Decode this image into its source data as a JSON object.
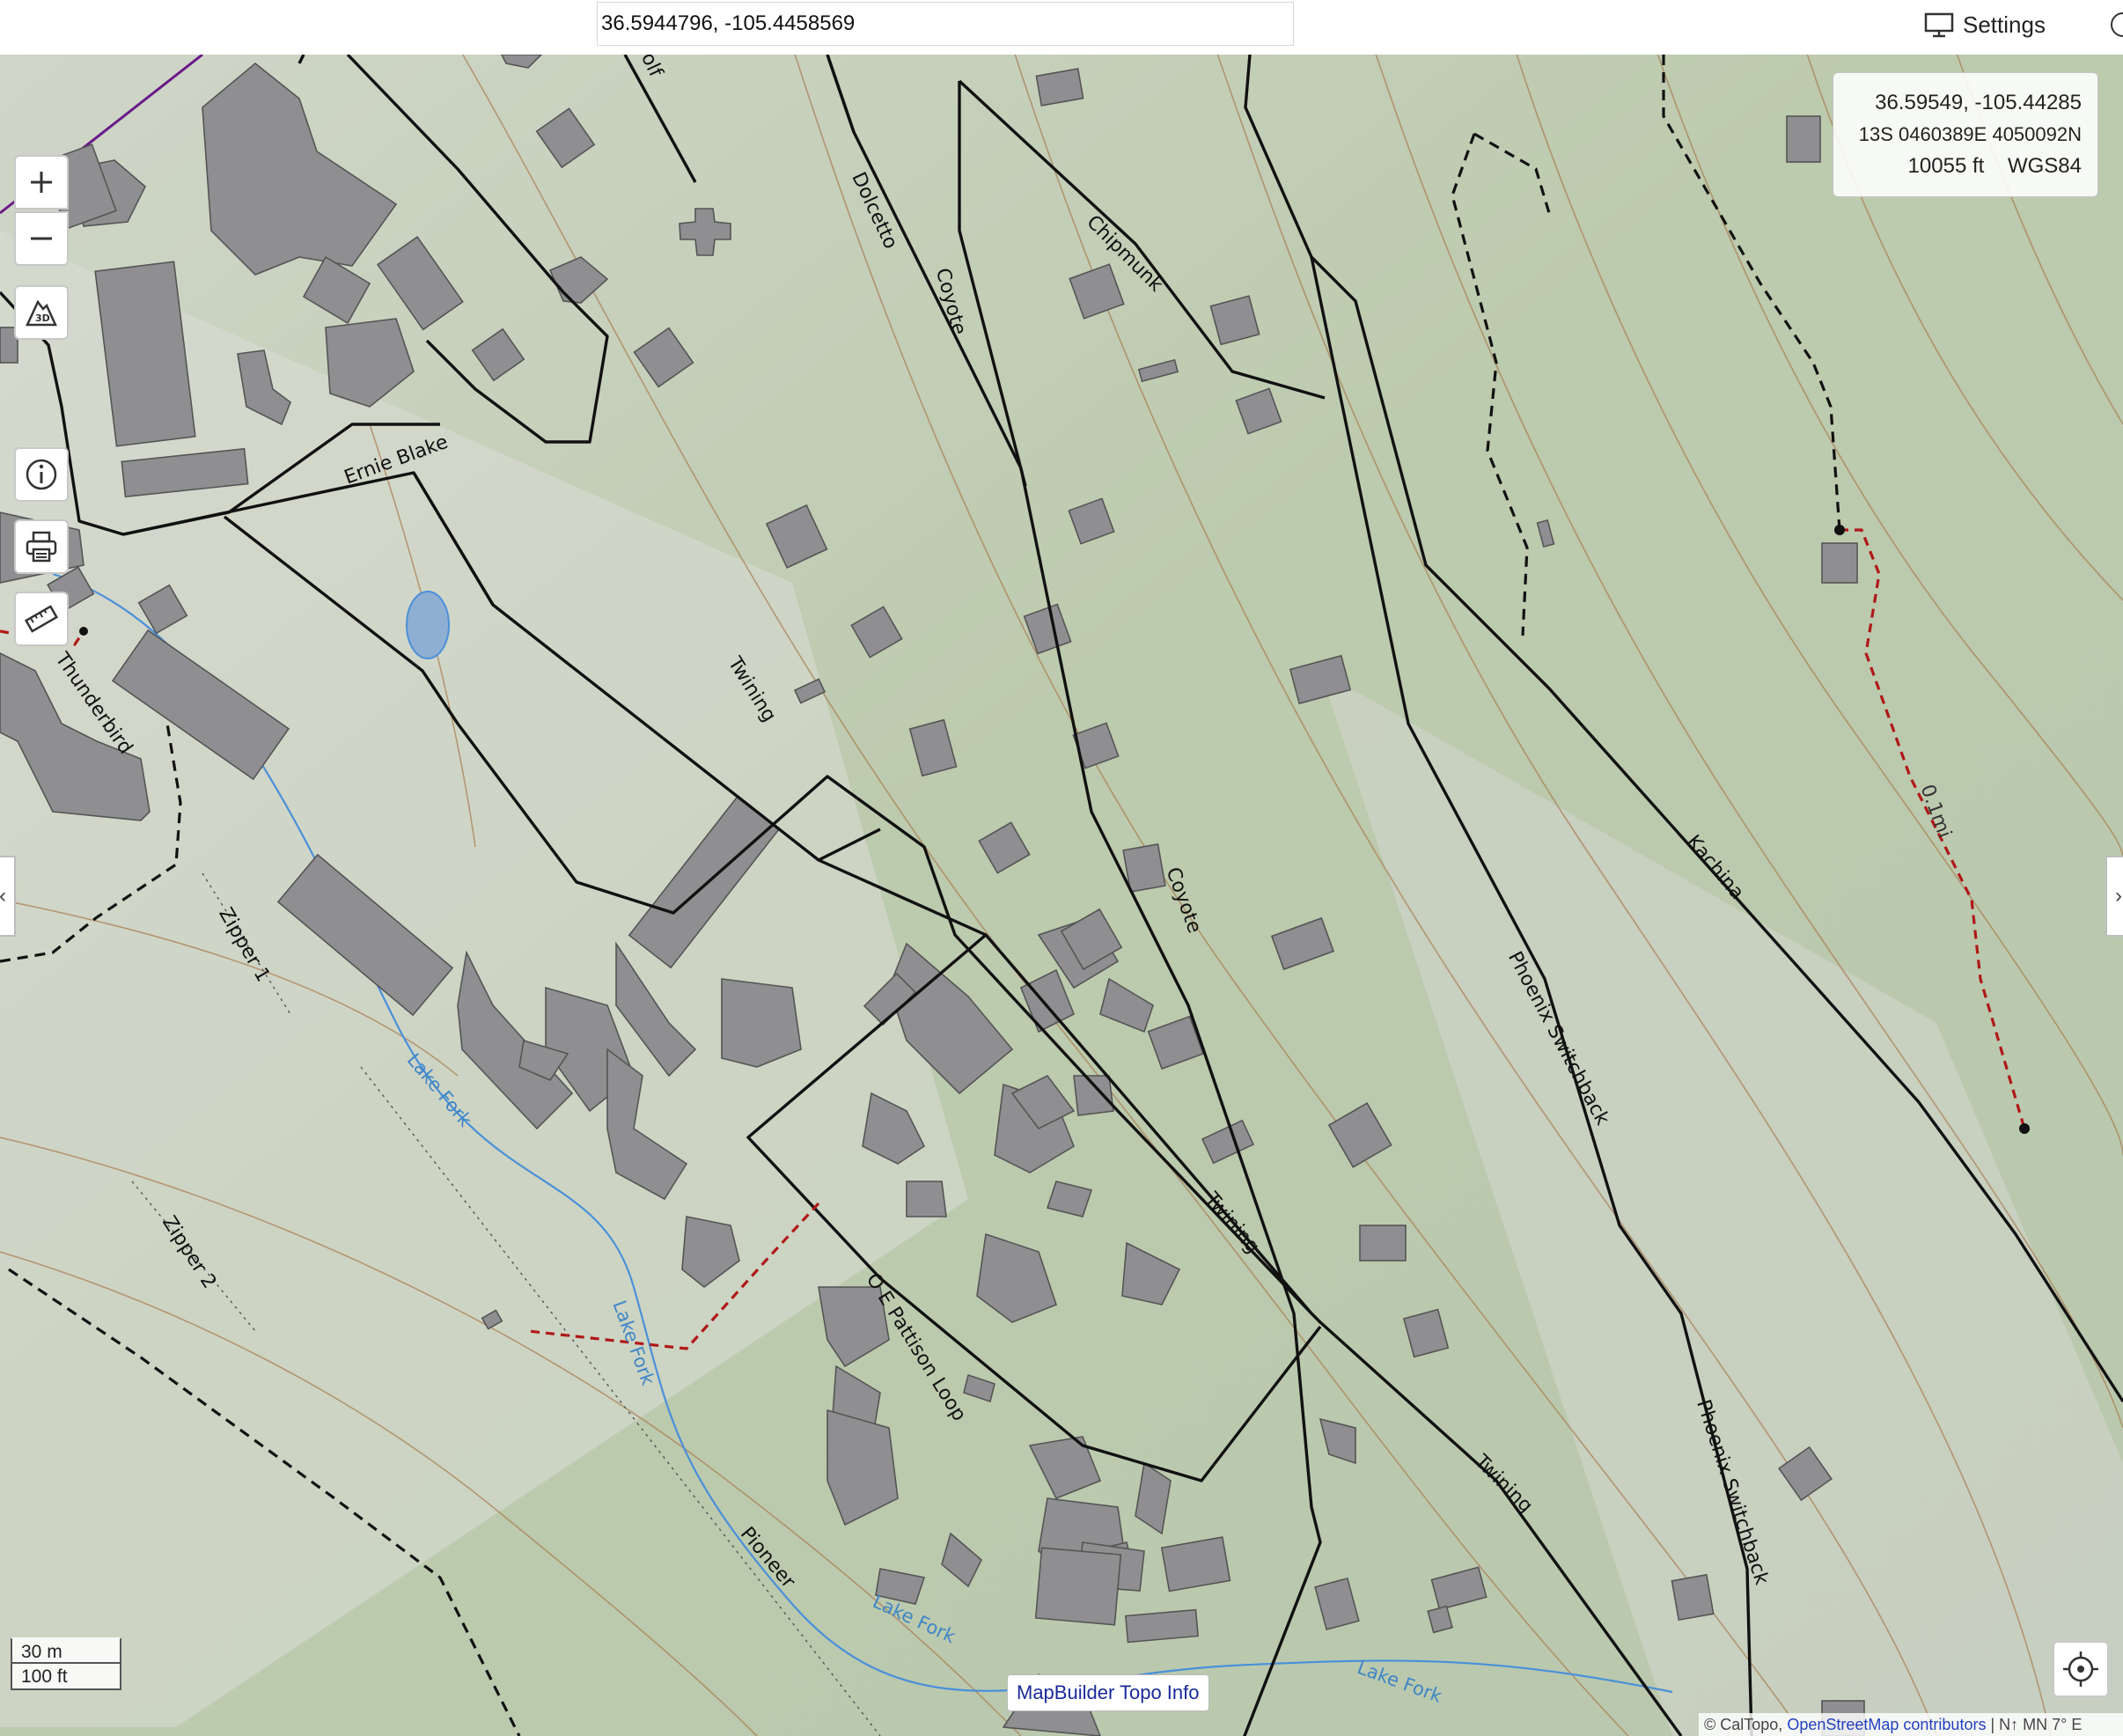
{
  "search": {
    "value": "36.5944796, -105.4458569"
  },
  "header": {
    "settings_label": "Settings"
  },
  "coords": {
    "latlon": "36.59549, -105.44285",
    "utm": "13S 0460389E 4050092N",
    "elevation": "10055 ft",
    "datum": "WGS84"
  },
  "controls": [
    {
      "name": "zoom-in-button",
      "icon": "plus-icon"
    },
    {
      "name": "zoom-out-button",
      "icon": "minus-icon"
    },
    {
      "name": "3d-button",
      "icon": "3d-mountain-icon",
      "text": "3D"
    },
    {
      "name": "info-button",
      "icon": "info-icon"
    },
    {
      "name": "print-button",
      "icon": "printer-icon"
    },
    {
      "name": "measure-button",
      "icon": "ruler-icon"
    }
  ],
  "scale": {
    "metric": "30 m",
    "imperial": "100 ft"
  },
  "topo_info_label": "MapBuilder Topo Info",
  "attribution": {
    "prefix": "© CalTopo,",
    "link": "OpenStreetMap contributors",
    "suffix": "| N↑ MN 7° E"
  },
  "map_labels": {
    "wolf": "Wolf",
    "dolcetto": "Dolcetto",
    "coyote": "Coyote",
    "chipmunk": "Chipmunk",
    "ernie_blake": "Ernie Blake",
    "twining": "Twining",
    "thunderbird": "Thunderbird",
    "zipper1": "Zipper 1",
    "zipper2": "Zipper 2",
    "lake_fork": "Lake Fork",
    "pattison": "O E Pattison Loop",
    "phoenix": "Phoenix Switchback",
    "kachina": "Kachina",
    "pioneer": "Pioneer",
    "distance": "0.1mi"
  },
  "colors": {
    "terrain": "#c9d3c1",
    "building": "#8f8f91",
    "trail": "#111111",
    "water": "#4a90d9",
    "route": "#b01818",
    "contour": "#a87c52"
  }
}
